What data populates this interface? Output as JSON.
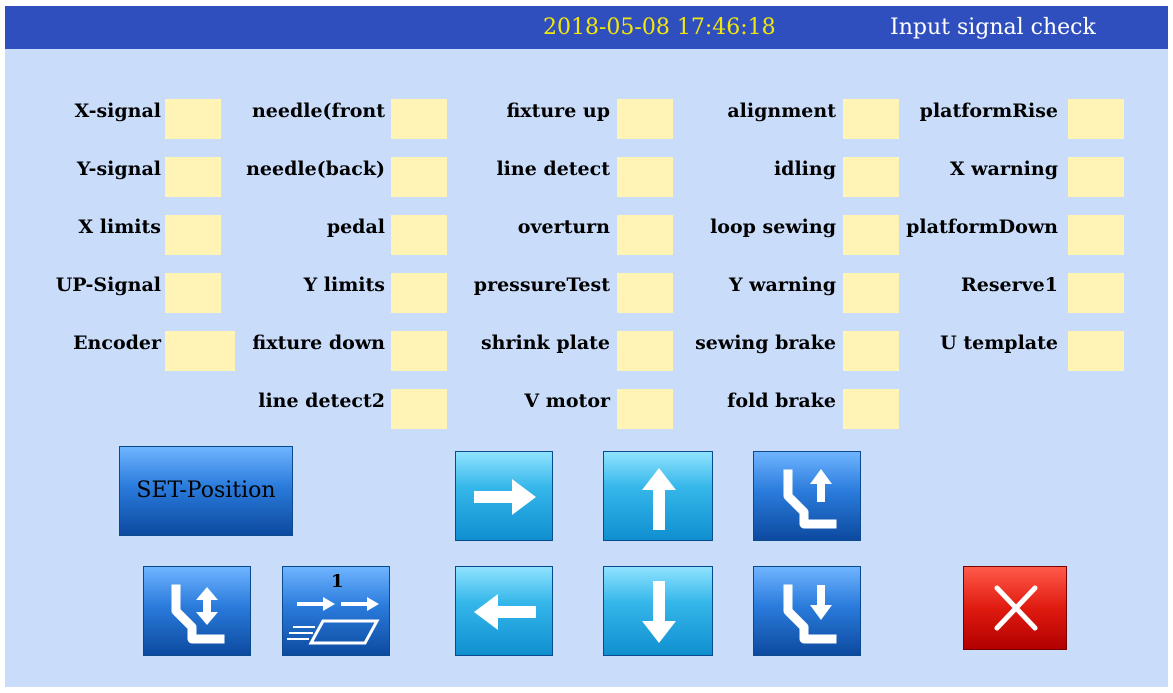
{
  "header": {
    "datetime": "2018-05-08 17:46:18",
    "title": "Input signal check"
  },
  "signals": {
    "x_signal": "X-signal",
    "y_signal": "Y-signal",
    "x_limits": "X limits",
    "up_signal": "UP-Signal",
    "encoder": "Encoder",
    "needle_front": "needle(front",
    "needle_back": "needle(back)",
    "pedal": "pedal",
    "y_limits": "Y limits",
    "fixture_down": "fixture down",
    "line_detect2": "line detect2",
    "fixture_up": "fixture up",
    "line_detect": "line detect",
    "overturn": "overturn",
    "pressure_test": "pressureTest",
    "shrink_plate": "shrink plate",
    "v_motor": "V motor",
    "alignment": "alignment",
    "idling": "idling",
    "loop_sewing": "loop sewing",
    "y_warning": "Y warning",
    "sewing_brake": "sewing brake",
    "fold_brake": "fold brake",
    "platform_rise": "platformRise",
    "x_warning": "X warning",
    "platform_down": "platformDown",
    "reserve1": "Reserve1",
    "u_template": "U template"
  },
  "buttons": {
    "set_position": "SET-Position",
    "step_badge": "1",
    "right_icon": "arrow-right-icon",
    "up_icon": "arrow-up-icon",
    "left_icon": "arrow-left-icon",
    "down_icon": "arrow-down-icon",
    "clamp_up_icon": "presser-up-icon",
    "clamp_down_icon": "presser-down-icon",
    "clamp_updown_icon": "presser-updown-icon",
    "feed_icon": "feed-step-icon",
    "close_icon": "close-icon"
  },
  "colors": {
    "background": "#c9dcfa",
    "title_bar": "#2f4fbf",
    "datetime_text": "#f2e60a",
    "indicator": "#fff4b5",
    "close_button": "#e01b10"
  }
}
